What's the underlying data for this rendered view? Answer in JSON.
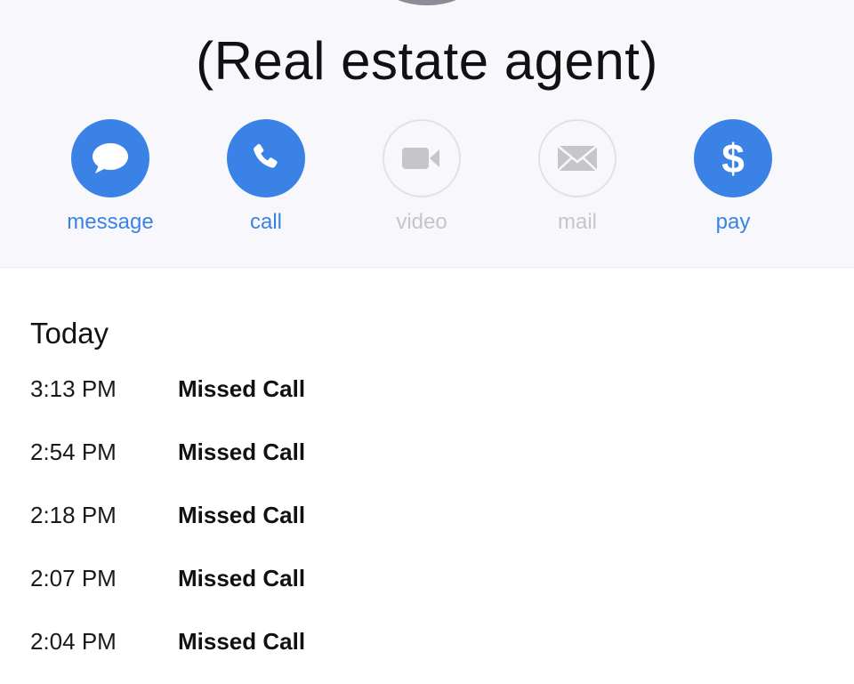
{
  "contact": {
    "name": "(Real estate agent)"
  },
  "actions": [
    {
      "id": "message",
      "label": "message",
      "icon": "message-bubble-icon",
      "enabled": true
    },
    {
      "id": "call",
      "label": "call",
      "icon": "phone-icon",
      "enabled": true
    },
    {
      "id": "video",
      "label": "video",
      "icon": "video-camera-icon",
      "enabled": false
    },
    {
      "id": "mail",
      "label": "mail",
      "icon": "envelope-icon",
      "enabled": false
    },
    {
      "id": "pay",
      "label": "pay",
      "icon": "dollar-icon",
      "enabled": true
    }
  ],
  "colors": {
    "accent": "#3b82e6",
    "disabled": "#c6c6ca"
  },
  "history": {
    "section_title": "Today",
    "calls": [
      {
        "time": "3:13 PM",
        "status": "Missed Call"
      },
      {
        "time": "2:54 PM",
        "status": "Missed Call"
      },
      {
        "time": "2:18 PM",
        "status": "Missed Call"
      },
      {
        "time": "2:07 PM",
        "status": "Missed Call"
      },
      {
        "time": "2:04 PM",
        "status": "Missed Call"
      }
    ]
  }
}
